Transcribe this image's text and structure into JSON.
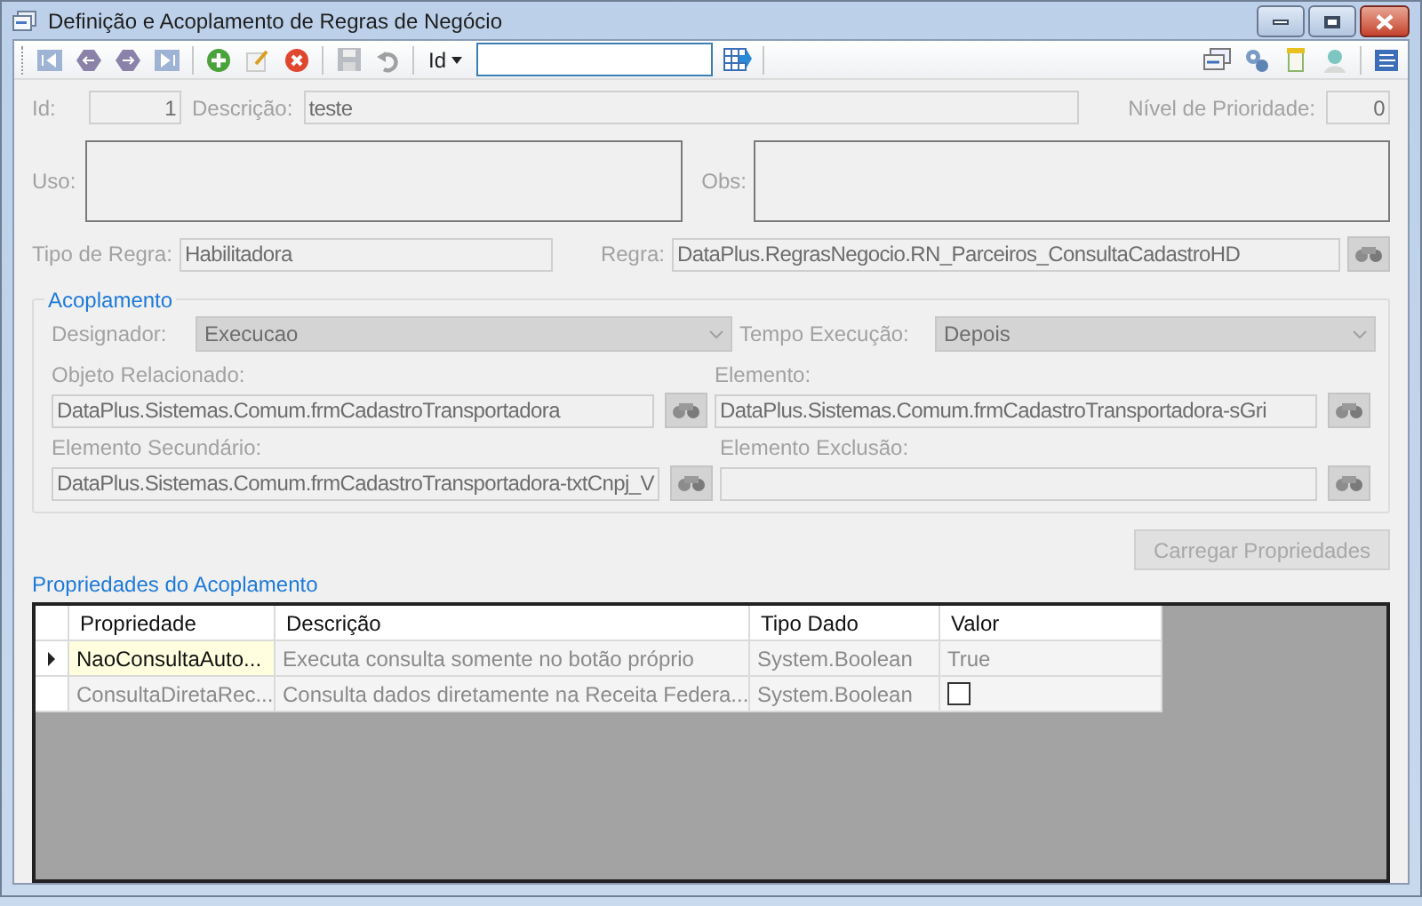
{
  "window": {
    "title": "Definição e Acoplamento de Regras de Negócio"
  },
  "toolbar": {
    "search_by": "Id"
  },
  "form": {
    "id_label": "Id:",
    "id": "1",
    "descricao_label": "Descrição:",
    "descricao": "teste",
    "prioridade_label": "Nível de Prioridade:",
    "prioridade": "0",
    "uso_label": "Uso:",
    "obs_label": "Obs:",
    "tipo_label": "Tipo de Regra:",
    "tipo": "Habilitadora",
    "regra_label": "Regra:",
    "regra": "DataPlus.RegrasNegocio.RN_Parceiros_ConsultaCadastroHD"
  },
  "acoplamento": {
    "title": "Acoplamento",
    "designador_label": "Designador:",
    "designador": "Execucao",
    "tempo_label": "Tempo Execução:",
    "tempo": "Depois",
    "objeto_label": "Objeto Relacionado:",
    "objeto": "DataPlus.Sistemas.Comum.frmCadastroTransportadora",
    "elemento_label": "Elemento:",
    "elemento": "DataPlus.Sistemas.Comum.frmCadastroTransportadora-sGri",
    "secundario_label": "Elemento Secundário:",
    "secundario": "DataPlus.Sistemas.Comum.frmCadastroTransportadora-txtCnpj_V",
    "exclusao_label": "Elemento Exclusão:"
  },
  "carregar_button": {
    "label": "Carregar Propriedades",
    "disabled": true
  },
  "propriedades": {
    "title": "Propriedades do Acoplamento",
    "columns": [
      "Propriedade",
      "Descrição",
      "Tipo Dado",
      "Valor"
    ],
    "rows": [
      {
        "selected": true,
        "propriedade": "NaoConsultaAuto...",
        "descricao": "Executa consulta somente no botão próprio",
        "tipo": "System.Boolean",
        "valor": {
          "kind": "text",
          "text": "True"
        }
      },
      {
        "selected": false,
        "propriedade": "ConsultaDiretaRec...",
        "descricao": "Consulta dados diretamente na Receita Federa...",
        "tipo": "System.Boolean",
        "valor": {
          "kind": "checkbox",
          "checked": false
        }
      }
    ]
  }
}
